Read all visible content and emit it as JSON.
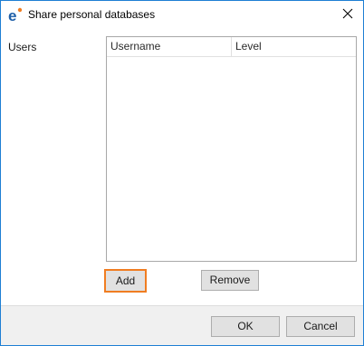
{
  "window": {
    "title": "Share personal databases",
    "accent_color": "#1e7fd4",
    "icons": {
      "app": "app-logo-icon",
      "close": "close-icon"
    }
  },
  "users_section": {
    "label": "Users",
    "table": {
      "columns": [
        "Username",
        "Level"
      ],
      "rows": []
    },
    "add_label": "Add",
    "remove_label": "Remove",
    "focus_color": "#f07d21"
  },
  "footer": {
    "ok_label": "OK",
    "cancel_label": "Cancel"
  }
}
